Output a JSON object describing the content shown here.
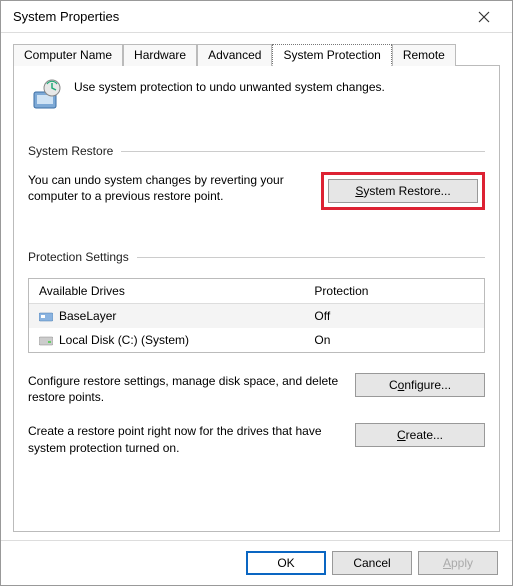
{
  "window": {
    "title": "System Properties"
  },
  "tabs": {
    "computer_name": "Computer Name",
    "hardware": "Hardware",
    "advanced": "Advanced",
    "system_protection": "System Protection",
    "remote": "Remote"
  },
  "header": {
    "description": "Use system protection to undo unwanted system changes."
  },
  "restore_group": {
    "label": "System Restore",
    "description": "You can undo system changes by reverting your computer to a previous restore point.",
    "button": "System Restore..."
  },
  "protection_group": {
    "label": "Protection Settings",
    "col_drives": "Available Drives",
    "col_protection": "Protection",
    "rows": [
      {
        "name": "BaseLayer",
        "protection": "Off"
      },
      {
        "name": "Local Disk (C:) (System)",
        "protection": "On"
      }
    ],
    "configure_text": "Configure restore settings, manage disk space, and delete restore points.",
    "configure_button": "Configure...",
    "create_text": "Create a restore point right now for the drives that have system protection turned on.",
    "create_button": "Create..."
  },
  "buttons": {
    "ok": "OK",
    "cancel": "Cancel",
    "apply": "Apply"
  }
}
